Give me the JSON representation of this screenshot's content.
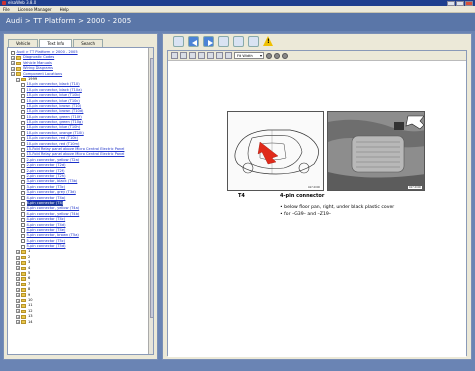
{
  "window": {
    "title": "elsaWeb 3.8.0"
  },
  "menu": [
    "File",
    "License Manager",
    "Help"
  ],
  "header": {
    "breadcrumb": "Audi > TT Platform > 2000 - 2005"
  },
  "left_tabs": [
    {
      "label": "Vehicle",
      "active": false
    },
    {
      "label": "Text Info",
      "active": true
    },
    {
      "label": "Search",
      "active": false
    }
  ],
  "tree": [
    {
      "indent": 0,
      "type": "doc",
      "text": "Audi > TT Platform > 2000 - 2005",
      "link": true
    },
    {
      "indent": 0,
      "type": "folder",
      "expander": "+",
      "text": "Diagnostic Codes",
      "link": true
    },
    {
      "indent": 0,
      "type": "folder",
      "expander": "+",
      "text": "Vehicle Manuals",
      "link": true
    },
    {
      "indent": 0,
      "type": "folder",
      "expander": "+",
      "text": "Wiring Diagrams",
      "link": true
    },
    {
      "indent": 0,
      "type": "folder",
      "expander": "−",
      "text": "Component Locations",
      "link": true
    },
    {
      "indent": 1,
      "type": "folder",
      "expander": "−",
      "text": "1999",
      "link": false
    },
    {
      "indent": 2,
      "type": "doc",
      "text": "10-pin connector, black (T10)",
      "link": true
    },
    {
      "indent": 2,
      "type": "doc",
      "text": "10-pin connector, black (T10a)",
      "link": true
    },
    {
      "indent": 2,
      "type": "doc",
      "text": "10-pin connector, blue (T10b)",
      "link": true
    },
    {
      "indent": 2,
      "type": "doc",
      "text": "10-pin connector, blue (T10c)",
      "link": true
    },
    {
      "indent": 2,
      "type": "doc",
      "text": "10-pin connector, brown (T10)",
      "link": true
    },
    {
      "indent": 2,
      "type": "doc",
      "text": "10-pin connector, brown (T10d)",
      "link": true
    },
    {
      "indent": 2,
      "type": "doc",
      "text": "10-pin connector, green (T10f)",
      "link": true
    },
    {
      "indent": 2,
      "type": "doc",
      "text": "10-pin connector, green (T10g)",
      "link": true
    },
    {
      "indent": 2,
      "type": "doc",
      "text": "10-pin connector, blue (T10h)",
      "link": true
    },
    {
      "indent": 2,
      "type": "doc",
      "text": "10-pin connector, orange (T10i)",
      "link": true
    },
    {
      "indent": 2,
      "type": "doc",
      "text": "10-pin connector, red (T10k)",
      "link": true
    },
    {
      "indent": 2,
      "type": "doc",
      "text": "10-pin connector, red (T10m)",
      "link": true
    },
    {
      "indent": 2,
      "type": "doc",
      "text": "15-Fold Relay panel above Micro Central Electric Panel",
      "link": true
    },
    {
      "indent": 2,
      "type": "doc",
      "text": "15-Fold Relay panel above Micro Central Electric Panel",
      "link": true
    },
    {
      "indent": 2,
      "type": "doc",
      "text": "2-pin connector, yellow (T2a)",
      "link": true
    },
    {
      "indent": 2,
      "type": "doc",
      "text": "2-pin connector (T2d)",
      "link": true
    },
    {
      "indent": 2,
      "type": "doc",
      "text": "2-pin connector (T2f)",
      "link": true
    },
    {
      "indent": 2,
      "type": "doc",
      "text": "2-pin connector (T2h)",
      "link": true
    },
    {
      "indent": 2,
      "type": "doc",
      "text": "3-pin connector, black (T3b)",
      "link": true
    },
    {
      "indent": 2,
      "type": "doc",
      "text": "3-pin connector (T3c)",
      "link": true
    },
    {
      "indent": 2,
      "type": "doc",
      "text": "3-pin connector, grey (T3d)",
      "link": true
    },
    {
      "indent": 2,
      "type": "doc",
      "text": "4-pin connector (T4a)",
      "link": true
    },
    {
      "indent": 2,
      "type": "doc",
      "text": "4-pin connector (T4)",
      "link": true,
      "selected": true
    },
    {
      "indent": 2,
      "type": "doc",
      "text": "4-pin connector, yellow (T4a)",
      "link": true
    },
    {
      "indent": 2,
      "type": "doc",
      "text": "4-pin connector, yellow (T4b)",
      "link": true
    },
    {
      "indent": 2,
      "type": "doc",
      "text": "4-pin connector (T4c)",
      "link": true
    },
    {
      "indent": 2,
      "type": "doc",
      "text": "4-pin connector (T4d)",
      "link": true
    },
    {
      "indent": 2,
      "type": "doc",
      "text": "4-pin connector (T4e)",
      "link": true
    },
    {
      "indent": 2,
      "type": "doc",
      "text": "5-pin connector, brown (T5a)",
      "link": true
    },
    {
      "indent": 2,
      "type": "doc",
      "text": "5-pin connector (T5c)",
      "link": true
    },
    {
      "indent": 2,
      "type": "doc",
      "text": "5-pin connector (T5d)",
      "link": true
    },
    {
      "indent": 1,
      "type": "folder",
      "expander": "+",
      "text": "1",
      "link": false
    },
    {
      "indent": 1,
      "type": "folder",
      "expander": "+",
      "text": "2",
      "link": false
    },
    {
      "indent": 1,
      "type": "folder",
      "expander": "+",
      "text": "3",
      "link": false
    },
    {
      "indent": 1,
      "type": "folder",
      "expander": "+",
      "text": "4",
      "link": false
    },
    {
      "indent": 1,
      "type": "folder",
      "expander": "+",
      "text": "5",
      "link": false
    },
    {
      "indent": 1,
      "type": "folder",
      "expander": "+",
      "text": "6",
      "link": false
    },
    {
      "indent": 1,
      "type": "folder",
      "expander": "+",
      "text": "7",
      "link": false
    },
    {
      "indent": 1,
      "type": "folder",
      "expander": "+",
      "text": "8",
      "link": false
    },
    {
      "indent": 1,
      "type": "folder",
      "expander": "+",
      "text": "9",
      "link": false
    },
    {
      "indent": 1,
      "type": "folder",
      "expander": "+",
      "text": "10",
      "link": false
    },
    {
      "indent": 1,
      "type": "folder",
      "expander": "+",
      "text": "11",
      "link": false
    },
    {
      "indent": 1,
      "type": "folder",
      "expander": "+",
      "text": "12",
      "link": false
    },
    {
      "indent": 1,
      "type": "folder",
      "expander": "+",
      "text": "13",
      "link": false
    },
    {
      "indent": 1,
      "type": "folder",
      "expander": "+",
      "text": "14",
      "link": false
    }
  ],
  "toolbar": {
    "icons": [
      "home-icon",
      "back-arrow-icon",
      "forward-arrow-icon",
      "refresh-icon",
      "document-icon",
      "print-icon",
      "warning-icon"
    ],
    "warning_glyph": "!"
  },
  "viewer": {
    "zoom": "Fit Width",
    "figure_labels": [
      "A97-0000",
      "A97-0000"
    ]
  },
  "content": {
    "code": "T4",
    "title": "4-pin connector",
    "bullets": [
      "• below floor pan, right, under black plastic cover",
      "• for –G39– and –Z19–"
    ]
  },
  "colors": {
    "title_bar": "#1f3f8e",
    "header": "#5a76a8",
    "link": "#1a2fc8",
    "selection": "#1e3a9e",
    "warning": "#f0c000"
  }
}
